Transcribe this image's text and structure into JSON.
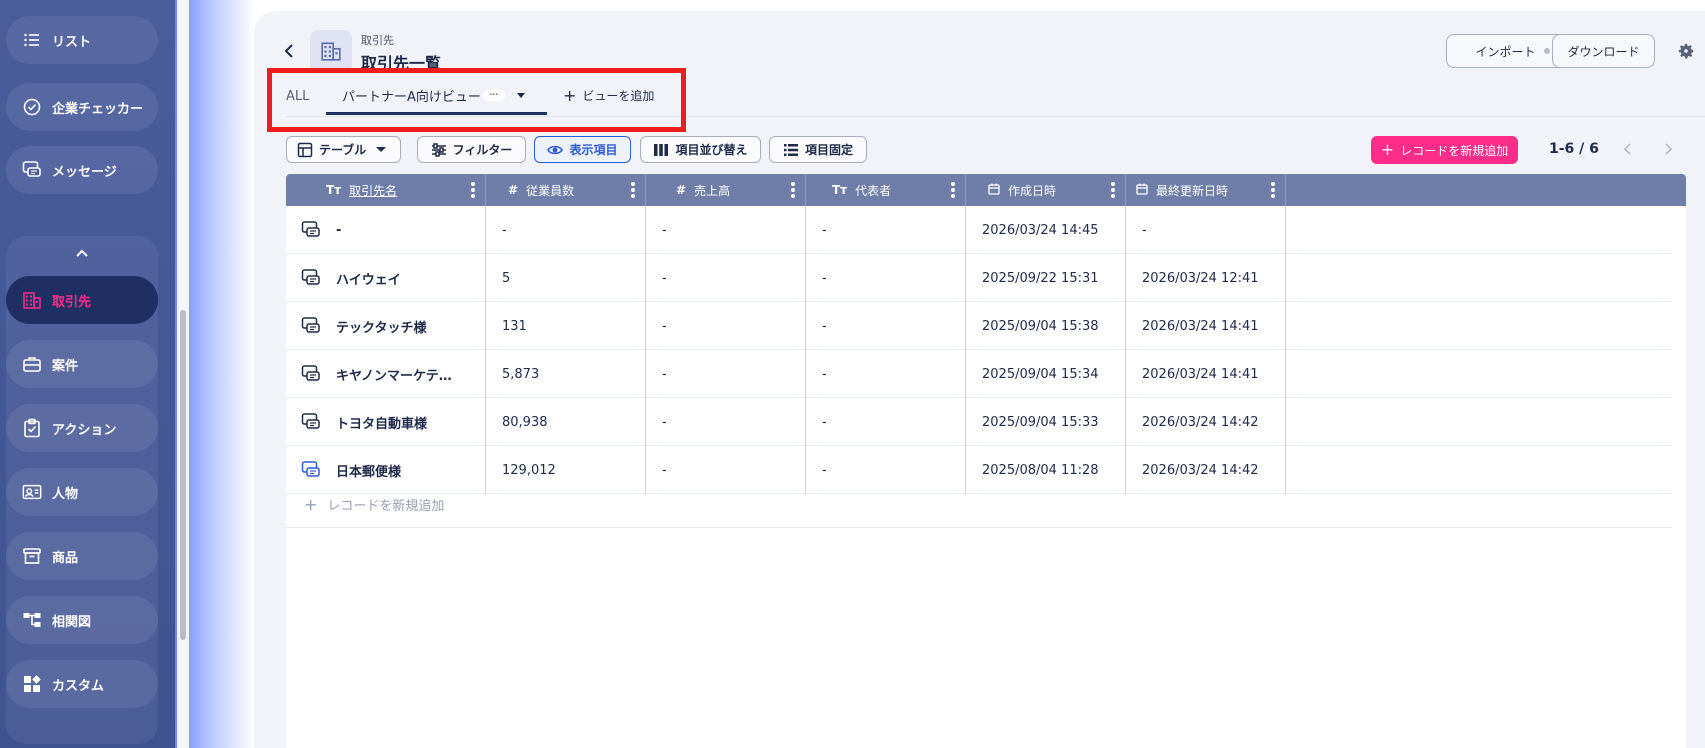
{
  "sidebar": {
    "items_top": [
      {
        "label": "リスト",
        "icon": "list-icon"
      },
      {
        "label": "企業チェッカー",
        "icon": "check-circle-icon"
      },
      {
        "label": "メッセージ",
        "icon": "message-icon"
      }
    ],
    "items": [
      {
        "label": "取引先",
        "icon": "building-icon",
        "active": true
      },
      {
        "label": "案件",
        "icon": "briefcase-icon"
      },
      {
        "label": "アクション",
        "icon": "clipboard-check-icon"
      },
      {
        "label": "人物",
        "icon": "contact-card-icon"
      },
      {
        "label": "商品",
        "icon": "archive-box-icon"
      },
      {
        "label": "相関図",
        "icon": "relation-diagram-icon"
      },
      {
        "label": "カスタム",
        "icon": "widgets-icon"
      }
    ]
  },
  "header": {
    "breadcrumb": "取引先",
    "title": "取引先一覧",
    "import_label": "インポート",
    "download_label": "ダウンロード"
  },
  "tabs": {
    "all_label": "ALL",
    "active_label": "パートナーA向けビュー",
    "add_view_label": "ビューを追加"
  },
  "toolbar": {
    "view_type_label": "テーブル",
    "filter_label": "フィルター",
    "display_items_label": "表示項目",
    "sort_items_label": "項目並び替え",
    "fix_items_label": "項目固定",
    "add_record_label": "レコードを新規追加",
    "pager_label": "1-6 / 6"
  },
  "table": {
    "columns": [
      {
        "label": "取引先名",
        "type": "Tт"
      },
      {
        "label": "従業員数",
        "type": "#"
      },
      {
        "label": "売上高",
        "type": "#"
      },
      {
        "label": "代表者",
        "type": "Tт"
      },
      {
        "label": "作成日時",
        "type": "calendar"
      },
      {
        "label": "最終更新日時",
        "type": "calendar"
      }
    ],
    "rows": [
      {
        "name": "-",
        "employees": "-",
        "sales": "-",
        "rep": "-",
        "created": "2026/03/24 14:45",
        "updated": "-"
      },
      {
        "name": "ハイウェイ",
        "employees": "5",
        "sales": "-",
        "rep": "-",
        "created": "2025/09/22 15:31",
        "updated": "2026/03/24 12:41"
      },
      {
        "name": "テックタッチ様",
        "employees": "131",
        "sales": "-",
        "rep": "-",
        "created": "2025/09/04 15:38",
        "updated": "2026/03/24 14:41"
      },
      {
        "name": "キヤノンマーケテ…",
        "employees": "5,873",
        "sales": "-",
        "rep": "-",
        "created": "2025/09/04 15:34",
        "updated": "2026/03/24 14:41"
      },
      {
        "name": "トヨタ自動車様",
        "employees": "80,938",
        "sales": "-",
        "rep": "-",
        "created": "2025/09/04 15:33",
        "updated": "2026/03/24 14:42"
      },
      {
        "name": "日本郵便様",
        "employees": "129,012",
        "sales": "-",
        "rep": "-",
        "created": "2025/08/04 11:28",
        "updated": "2026/03/24 14:42"
      }
    ],
    "add_row_label": "レコードを新規追加"
  },
  "colors": {
    "accent_pink": "#ff2d8a",
    "sidebar_bg": "#4a5d9b",
    "header_bg": "#6e7ea9",
    "highlight_red": "#ee1c1c",
    "link_blue": "#2d5bd7"
  }
}
